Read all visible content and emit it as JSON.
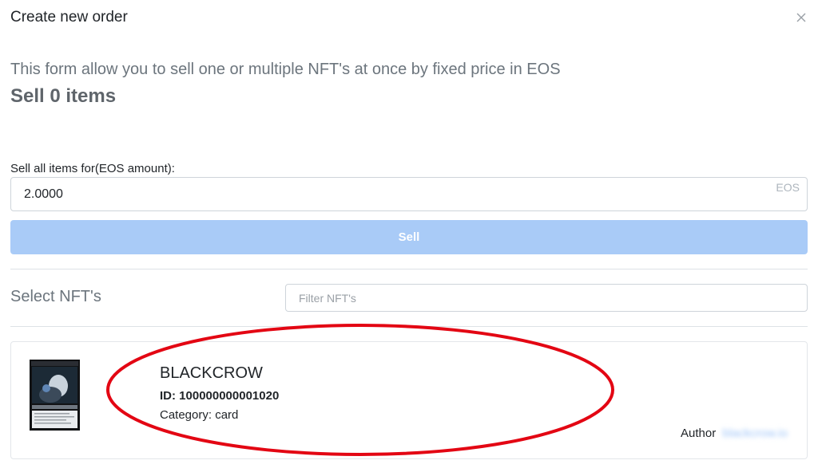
{
  "modal": {
    "title": "Create new order",
    "close_icon": "close-icon"
  },
  "form": {
    "description": "This form allow you to sell one or multiple NFT's at once by fixed price in EOS",
    "sell_count": "Sell 0 items",
    "amount_label": "Sell all items for(EOS amount):",
    "amount_value": "2.0000",
    "amount_suffix": "EOS",
    "sell_button": "Sell"
  },
  "selection": {
    "heading": "Select NFT's",
    "filter_placeholder": "Filter NFT's"
  },
  "nft": {
    "name": "BLACKCROW",
    "id_text": "ID: 100000000001020",
    "category_text": "Category: card",
    "author_label": "Author",
    "author_value": "blackcrow.io"
  },
  "colors": {
    "sell_button": "#a9cbf7",
    "highlight": "#e30613",
    "author_link": "#9fc5f8"
  }
}
